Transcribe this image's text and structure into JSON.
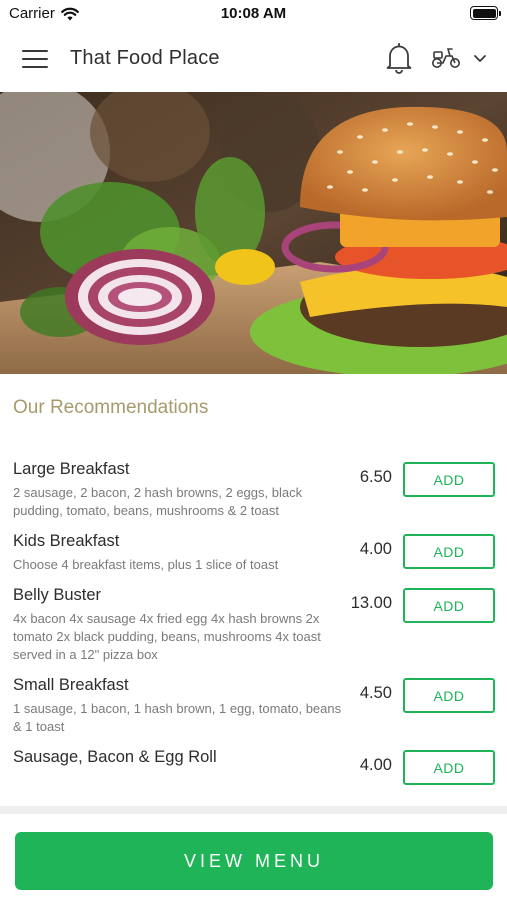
{
  "status_bar": {
    "carrier": "Carrier",
    "time": "10:08 AM"
  },
  "nav": {
    "title": "That Food Place",
    "icons": [
      "menu-icon",
      "bell-icon",
      "scooter-icon",
      "chevron-down-icon"
    ]
  },
  "hero": {
    "image": "burger-photo"
  },
  "section": {
    "heading": "Our Recommendations"
  },
  "items": [
    {
      "name": "Large Breakfast",
      "description": "2 sausage, 2 bacon, 2 hash browns, 2 eggs, black pudding, tomato, beans, mushrooms & 2 toast",
      "price": "6.50",
      "add_label": "ADD"
    },
    {
      "name": "Kids Breakfast",
      "description": "Choose 4 breakfast items, plus 1 slice of toast",
      "price": "4.00",
      "add_label": "ADD"
    },
    {
      "name": "Belly Buster",
      "description": "4x bacon 4x sausage 4x fried egg 4x hash browns 2x tomato 2x black pudding, beans, mushrooms 4x toast served in a 12\" pizza box",
      "price": "13.00",
      "add_label": "ADD"
    },
    {
      "name": "Small Breakfast",
      "description": "1 sausage, 1 bacon, 1 hash brown, 1 egg, tomato, beans & 1 toast",
      "price": "4.50",
      "add_label": "ADD"
    },
    {
      "name": "Sausage, Bacon & Egg Roll",
      "description": "",
      "price": "4.00",
      "add_label": "ADD"
    }
  ],
  "footer": {
    "view_menu_label": "VIEW MENU"
  },
  "colors": {
    "accent_green": "#1fb457",
    "heading_gold": "#a79a6d"
  }
}
